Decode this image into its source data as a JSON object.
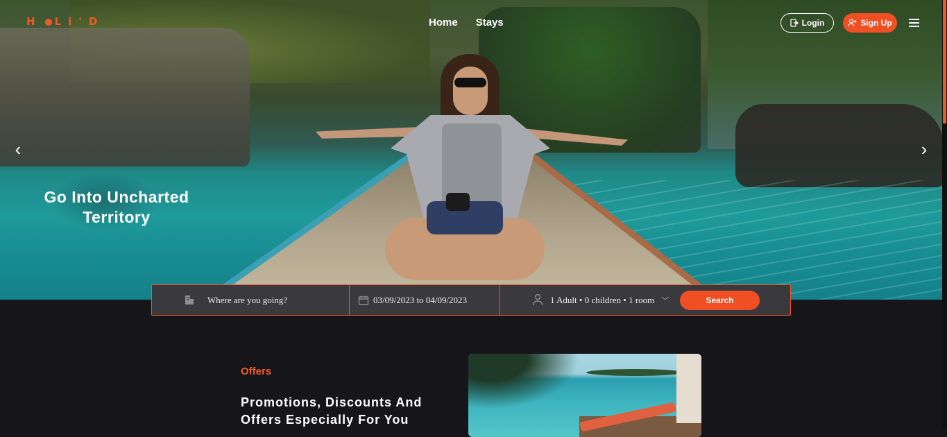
{
  "brand": {
    "logo_left": "H",
    "logo_right": "Li'D",
    "accent_color": "#f05a28"
  },
  "nav": {
    "items": [
      "Home",
      "Stays"
    ]
  },
  "header_actions": {
    "login_label": "Login",
    "signup_label": "Sign Up"
  },
  "hero": {
    "title": "Go Into Uncharted Territory"
  },
  "search": {
    "destination_placeholder": "Where are you going?",
    "dates": "03/09/2023 to 04/09/2023",
    "guests": "1 Adult • 0 children • 1 room",
    "button_label": "Search"
  },
  "offers": {
    "kicker": "Offers",
    "title": "Promotions, Discounts And Offers Especially For You"
  },
  "icons": {
    "login": "login-icon",
    "signup": "user-plus-icon",
    "menu": "hamburger-menu-icon",
    "building": "building-icon",
    "calendar": "calendar-icon",
    "person": "person-icon",
    "chevron": "chevron-down-icon",
    "prev": "chevron-left-icon",
    "next": "chevron-right-icon"
  }
}
